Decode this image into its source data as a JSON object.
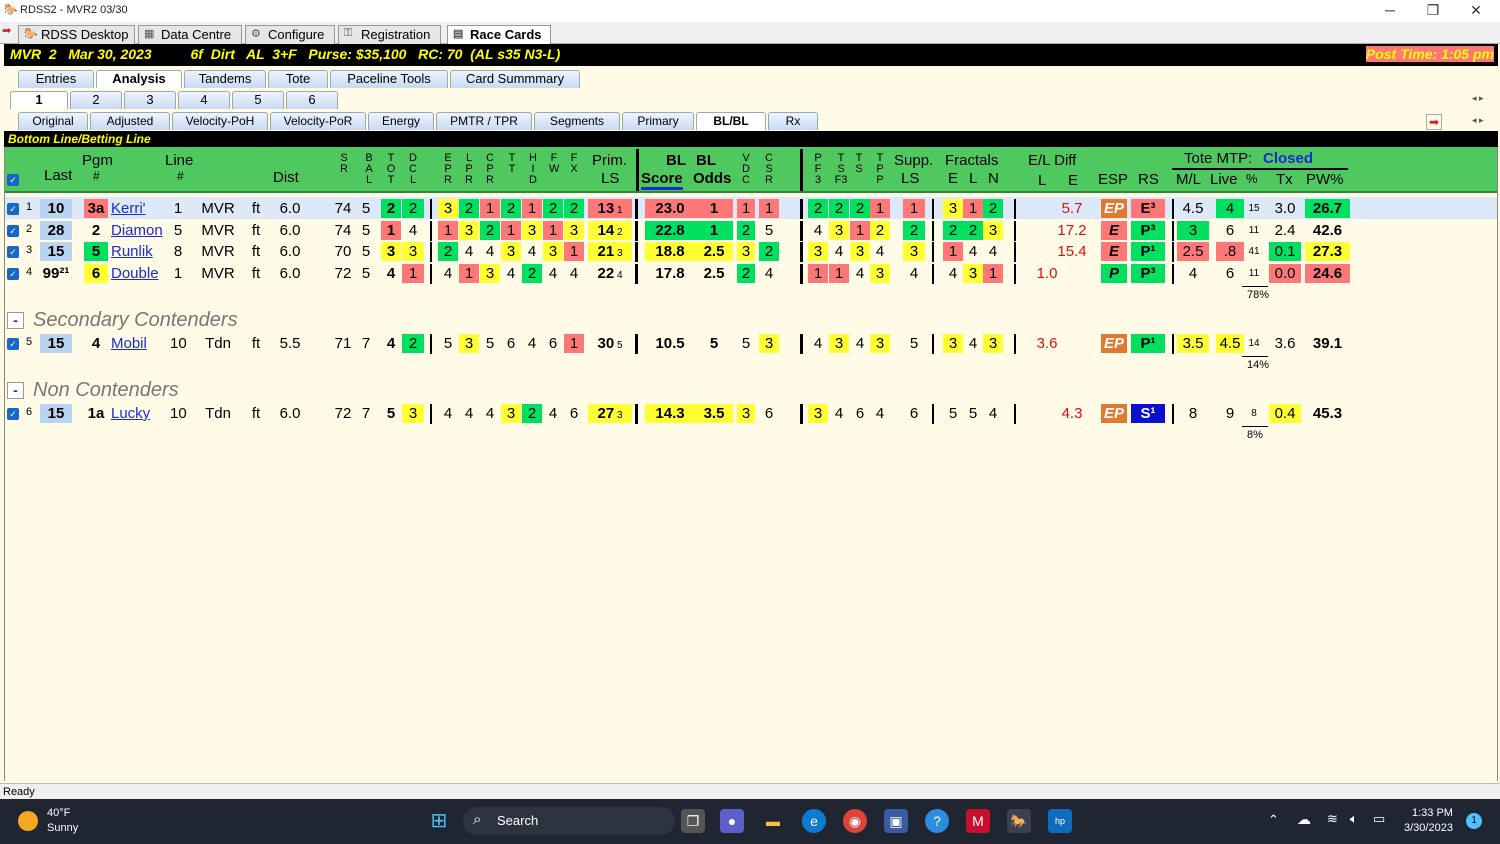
{
  "window": {
    "title": "RDSS2 - MVR2  03/30",
    "min": "─",
    "max": "❐",
    "close": "✕"
  },
  "app_tabs": [
    {
      "label": "RDSS Desktop"
    },
    {
      "label": "Data Centre"
    },
    {
      "label": "Configure"
    },
    {
      "label": "Registration"
    },
    {
      "label": "Race Cards"
    }
  ],
  "race_bar": {
    "left": "MVR  2   Mar 30, 2023          6f  Dirt   AL  3+F   Purse: $35,100   RC: 70  (AL s35 N3-L)",
    "right": "Post Time: 1:05 pm"
  },
  "main_tabs": [
    "Entries",
    "Analysis",
    "Tandems",
    "Tote",
    "Paceline Tools",
    "Card Summmary"
  ],
  "race_tabs": [
    "1",
    "2",
    "3",
    "4",
    "5",
    "6"
  ],
  "sub_tabs": [
    "Original",
    "Adjusted",
    "Velocity-PoH",
    "Velocity-PoR",
    "Energy",
    "PMTR / TPR",
    "Segments",
    "Primary",
    "BL/BL",
    "Rx"
  ],
  "section_title": "Bottom Line/Betting Line",
  "headers": {
    "last": "Last",
    "pgm": "Pgm",
    "pgm_hash": "#",
    "line": "Line",
    "line_hash": "#",
    "dist": "Dist",
    "prim": "Prim.",
    "ls": "LS",
    "bl1": "BL",
    "bl2": "BL",
    "score": "Score",
    "odds": "Odds",
    "supp": "Supp.",
    "supp_ls": "LS",
    "fractals": "Fractals",
    "e": "E",
    "l": "L",
    "n": "N",
    "eldiff": "E/L Diff",
    "el_l": "L",
    "el_e": "E",
    "esp": "ESP",
    "rs": "RS",
    "tote": "Tote MTP:",
    "tote_status": "Closed",
    "ml": "M/L",
    "live": "Live",
    "pct": "%",
    "tx": "Tx",
    "pw": "PW%",
    "sr": "S R",
    "bal": "B A L",
    "tot": "T O T",
    "dcl": "D C L",
    "epr": "E P R",
    "lpr": "L P R",
    "cpr": "C P R",
    "tt": "T T",
    "hid": "H I D",
    "fw": "F W",
    "fx": "F X",
    "vdc": "V D C",
    "csr": "C S R",
    "pf3": "P F 3",
    "tsf3": "T S F3",
    "ts": "T S",
    "tpp": "T P P"
  },
  "rows": [
    {
      "n": "1",
      "last": "10",
      "pgm": "3a",
      "name": "Kerri'",
      "line": "1",
      "trk": "MVR",
      "sf": "ft",
      "dist": "6.0",
      "sr": "74",
      "bal": "5",
      "tot": "2",
      "dcl": "2",
      "epr": "3",
      "lpr": "2",
      "cpr": "1",
      "tt": "2",
      "hid": "1",
      "fw": "2",
      "fx": "2",
      "prim": "13",
      "prim_s": "1",
      "score": "23.0",
      "odds": "1",
      "vdc": "1",
      "csr": "1",
      "pf3": "2",
      "tsf3": "2",
      "ts": "2",
      "tpp": "1",
      "supp": "1",
      "fe": "3",
      "fl": "1",
      "fn": "2",
      "el_l": "",
      "el_e": "5.7",
      "esp": "EP",
      "rs": "E³",
      "ml": "4.5",
      "live": "4",
      "pct": "15",
      "tx": "3.0",
      "pw": "26.7"
    },
    {
      "n": "2",
      "last": "28",
      "pgm": "2",
      "name": "Diamon",
      "line": "5",
      "trk": "MVR",
      "sf": "ft",
      "dist": "6.0",
      "sr": "74",
      "bal": "5",
      "tot": "1",
      "dcl": "4",
      "epr": "1",
      "lpr": "3",
      "cpr": "2",
      "tt": "1",
      "hid": "3",
      "fw": "1",
      "fx": "3",
      "prim": "14",
      "prim_s": "2",
      "score": "22.8",
      "odds": "1",
      "vdc": "2",
      "csr": "5",
      "pf3": "4",
      "tsf3": "3",
      "ts": "1",
      "tpp": "2",
      "supp": "2",
      "fe": "2",
      "fl": "2",
      "fn": "3",
      "el_l": "",
      "el_e": "17.2",
      "esp": "E",
      "rs": "P³",
      "ml": "3",
      "live": "6",
      "pct": "11",
      "tx": "2.4",
      "pw": "42.6"
    },
    {
      "n": "3",
      "last": "15",
      "pgm": "5",
      "name": "Runlik",
      "line": "8",
      "trk": "MVR",
      "sf": "ft",
      "dist": "6.0",
      "sr": "70",
      "bal": "5",
      "tot": "3",
      "dcl": "3",
      "epr": "2",
      "lpr": "4",
      "cpr": "4",
      "tt": "3",
      "hid": "4",
      "fw": "3",
      "fx": "1",
      "prim": "21",
      "prim_s": "3",
      "score": "18.8",
      "odds": "2.5",
      "vdc": "3",
      "csr": "2",
      "pf3": "3",
      "tsf3": "4",
      "ts": "3",
      "tpp": "4",
      "supp": "3",
      "fe": "1",
      "fl": "4",
      "fn": "4",
      "el_l": "",
      "el_e": "15.4",
      "esp": "E",
      "rs": "P¹",
      "ml": "2.5",
      "live": ".8",
      "pct": "41",
      "tx": "0.1",
      "pw": "27.3"
    },
    {
      "n": "4",
      "last": "99²¹",
      "pgm": "6",
      "name": "Double",
      "line": "1",
      "trk": "MVR",
      "sf": "ft",
      "dist": "6.0",
      "sr": "72",
      "bal": "5",
      "tot": "4",
      "dcl": "1",
      "epr": "4",
      "lpr": "1",
      "cpr": "3",
      "tt": "4",
      "hid": "2",
      "fw": "4",
      "fx": "4",
      "prim": "22",
      "prim_s": "4",
      "score": "17.8",
      "odds": "2.5",
      "vdc": "2",
      "csr": "4",
      "pf3": "1",
      "tsf3": "1",
      "ts": "4",
      "tpp": "3",
      "supp": "4",
      "fe": "4",
      "fl": "3",
      "fn": "1",
      "el_l": "1.0",
      "el_e": "",
      "esp": "P",
      "rs": "P³",
      "ml": "4",
      "live": "6",
      "pct": "11",
      "tx": "0.0",
      "pw": "24.6",
      "sum": "78%"
    },
    {
      "n": "5",
      "last": "15",
      "pgm": "4",
      "name": "Mobil",
      "line": "10",
      "trk": "Tdn",
      "sf": "ft",
      "dist": "5.5",
      "sr": "71",
      "bal": "7",
      "tot": "4",
      "dcl": "2",
      "epr": "5",
      "lpr": "3",
      "cpr": "5",
      "tt": "6",
      "hid": "4",
      "fw": "6",
      "fx": "1",
      "prim": "30",
      "prim_s": "5",
      "score": "10.5",
      "odds": "5",
      "vdc": "5",
      "csr": "3",
      "pf3": "4",
      "tsf3": "3",
      "ts": "4",
      "tpp": "3",
      "supp": "5",
      "fe": "3",
      "fl": "4",
      "fn": "3",
      "el_l": "3.6",
      "el_e": "",
      "esp": "EP",
      "rs": "P¹",
      "ml": "3.5",
      "live": "4.5",
      "pct": "14",
      "tx": "3.6",
      "pw": "39.1",
      "sum": "14%"
    },
    {
      "n": "6",
      "last": "15",
      "pgm": "1a",
      "name": "Lucky",
      "line": "10",
      "trk": "Tdn",
      "sf": "ft",
      "dist": "6.0",
      "sr": "72",
      "bal": "7",
      "tot": "5",
      "dcl": "3",
      "epr": "4",
      "lpr": "4",
      "cpr": "4",
      "tt": "3",
      "hid": "2",
      "fw": "4",
      "fx": "6",
      "prim": "27",
      "prim_s": "3",
      "score": "14.3",
      "odds": "3.5",
      "vdc": "3",
      "csr": "6",
      "pf3": "3",
      "tsf3": "4",
      "ts": "6",
      "tpp": "4",
      "supp": "6",
      "fe": "5",
      "fl": "5",
      "fn": "4",
      "el_l": "",
      "el_e": "4.3",
      "esp": "EP",
      "rs": "S¹",
      "ml": "8",
      "live": "9",
      "pct": "8",
      "tx": "0.4",
      "pw": "45.3",
      "sum": "8%"
    }
  ],
  "groups": {
    "secondary": "Secondary Contenders",
    "non": "Non Contenders",
    "collapse": "-"
  },
  "status": "Ready",
  "taskbar": {
    "temp": "40°F",
    "weather": "Sunny",
    "search": "Search",
    "time": "1:33 PM",
    "date": "3/30/2023",
    "badge": "1"
  }
}
